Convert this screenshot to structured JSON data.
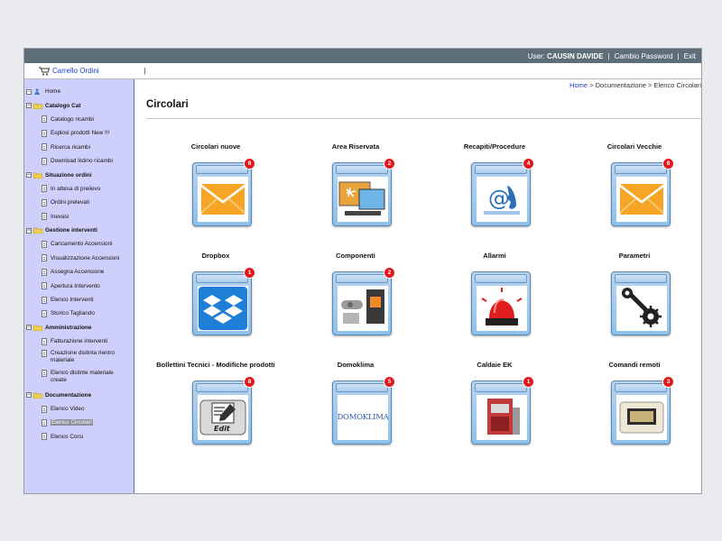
{
  "topbar": {
    "user_label": "User:",
    "user_name": "CAUSIN DAVIDE",
    "sep1": "|",
    "change_password": "Cambio Password",
    "sep2": "|",
    "exit": "Exit"
  },
  "toolbar": {
    "cart_label": "Carrello Ordini",
    "bar": "|"
  },
  "sidebar": {
    "home": "Home",
    "groups": [
      {
        "label": "Catalogo Cat",
        "items": [
          "Catalogo ricambi",
          "Esplosi prodotti New !!!",
          "Ricerca ricambi",
          "Download listino ricambi"
        ]
      },
      {
        "label": "Situazione ordini",
        "items": [
          "In attesa di prelievo",
          "Ordini prelevati",
          "Inevasi"
        ]
      },
      {
        "label": "Gestione interventi",
        "items": [
          "Caricamento Accensioni",
          "Visualizzazione Accensioni",
          "Assegna Accensione",
          "Apertura Intervento",
          "Elenco Interventi",
          "Storico Tagliando"
        ]
      },
      {
        "label": "Amministrazione",
        "items": [
          "Fatturazione interventi",
          "Creazione distinta rientro materiale",
          "Elenco distinte materiale create"
        ]
      },
      {
        "label": "Documentazione",
        "items": [
          "Elenco Video",
          "Elenco Circolari",
          "Elenco Corsi"
        ]
      }
    ]
  },
  "breadcrumb": {
    "home": "Home",
    "rest": " > Documentazione > Elenco Circolari"
  },
  "page_title": "Circolari",
  "tiles": [
    {
      "label": "Circolari nuove",
      "badge": "8",
      "icon": "envelope-icon"
    },
    {
      "label": "Area Riservata",
      "badge": "2",
      "icon": "computer-icon"
    },
    {
      "label": "Recapiti/Procedure",
      "badge": "4",
      "icon": "contact-icon"
    },
    {
      "label": "Circolari Vecchie",
      "badge": "8",
      "icon": "envelope-icon"
    },
    {
      "label": "Dropbox",
      "badge": "1",
      "icon": "dropbox-icon"
    },
    {
      "label": "Componenti",
      "badge": "2",
      "icon": "components-icon"
    },
    {
      "label": "Allarmi",
      "badge": "",
      "icon": "alarm-light-icon"
    },
    {
      "label": "Parametri",
      "badge": "",
      "icon": "wrench-gear-icon"
    },
    {
      "label": "Bollettini Tecnici - Modifiche prodotti",
      "badge": "8",
      "icon": "edit-icon"
    },
    {
      "label": "Domoklima",
      "badge": "5",
      "icon": "domoklima-logo",
      "logo_text": "DOMOKLIMA"
    },
    {
      "label": "Caldaie EK",
      "badge": "1",
      "icon": "boiler-icon"
    },
    {
      "label": "Comandi remoti",
      "badge": "3",
      "icon": "remote-control-icon"
    }
  ],
  "colors": {
    "topbar": "#5e6e79",
    "sidebar": "#cfcffb",
    "badge": "#e3161b",
    "link": "#1a3fc9"
  }
}
